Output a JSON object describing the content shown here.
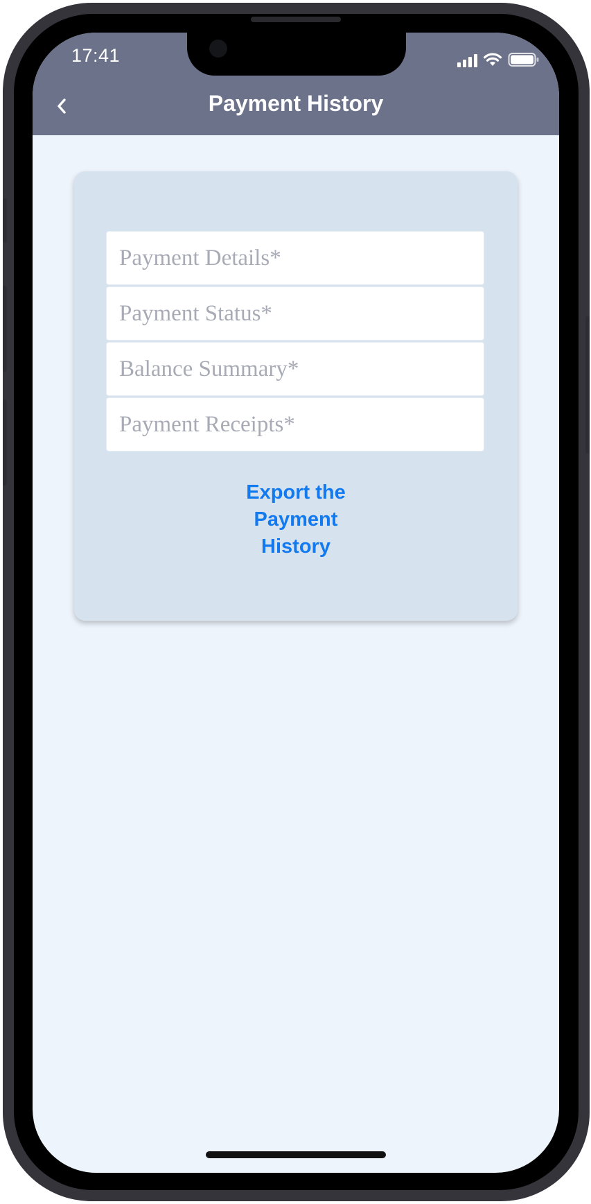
{
  "status_bar": {
    "time": "17:41"
  },
  "header": {
    "title": "Payment History",
    "back_icon": "chevron-left-icon"
  },
  "form": {
    "fields": [
      {
        "placeholder": "Payment Details*",
        "value": ""
      },
      {
        "placeholder": "Payment Status*",
        "value": ""
      },
      {
        "placeholder": "Balance Summary*",
        "value": ""
      },
      {
        "placeholder": "Payment Receipts*",
        "value": ""
      }
    ],
    "export_label": "Export the Payment History"
  },
  "colors": {
    "header_bg": "#6b7289",
    "screen_bg": "#eef4fc",
    "card_bg": "#d6e3ef",
    "link": "#1279ef"
  }
}
